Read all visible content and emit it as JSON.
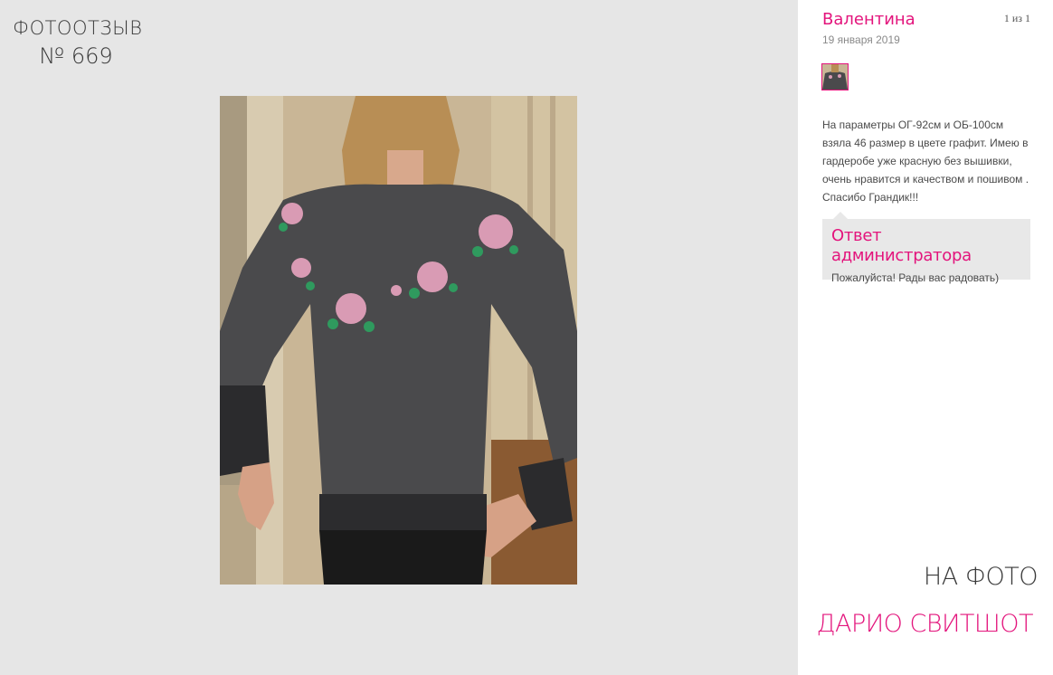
{
  "header": {
    "title_line1": "ФОТООТЗЫВ",
    "title_line2": "№ 669"
  },
  "review": {
    "author": "Валентина",
    "counter": "1 из 1",
    "date": "19 января 2019",
    "text": "На параметры ОГ-92см и ОБ-100см взяла 46 размер в цвете графит. Имею в гардеробе уже красную без вышивки, очень нравится и качеством и пошивом . Спасибо Грандик!!!"
  },
  "admin_reply": {
    "title": "Ответ администратора",
    "text": "Пожалуйста! Рады вас радовать)"
  },
  "caption": {
    "on_photo": "НА ФОТО",
    "product": "ДАРИО СВИТШОТ"
  },
  "colors": {
    "accent": "#e3147c",
    "left_bg": "#e6e6e6",
    "admin_bg": "#e8e8e8"
  },
  "icons": {
    "thumbnail": "photo-thumbnail",
    "main_photo": "review-photo"
  }
}
